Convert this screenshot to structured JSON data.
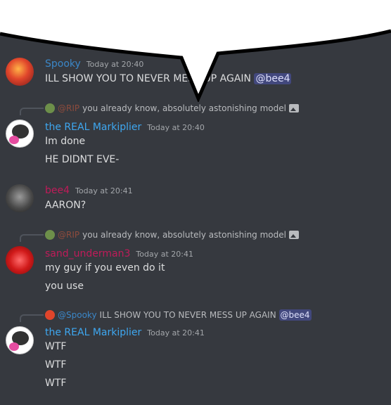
{
  "messages": [
    {
      "author": "Spooky",
      "author_color": "#3b87c8",
      "time": "Today at 20:40",
      "lines": [
        "ILL SHOW YOU TO NEVER MESS UP AGAIN"
      ],
      "mention": "@bee4"
    },
    {
      "reply": {
        "author": "@RIP",
        "text": "you already know, absolutely astonishing model"
      },
      "author": "the REAL Markiplier",
      "author_color": "#3ea7f0",
      "time": "Today at 20:40",
      "lines": [
        "Im done",
        "HE DIDNT EVE-"
      ]
    },
    {
      "author": "bee4",
      "author_color": "#c01b59",
      "time": "Today at 20:41",
      "lines": [
        "AARON?"
      ]
    },
    {
      "reply": {
        "author": "@RIP",
        "text": "you already know, absolutely astonishing model"
      },
      "author": "sand_underman3",
      "author_color": "#c01b59",
      "time": "Today at 20:41",
      "lines": [
        "my guy if you even do it",
        "you use"
      ]
    },
    {
      "reply": {
        "author": "@Spooky",
        "text": "ILL SHOW YOU TO NEVER MESS UP AGAIN",
        "mention": "@bee4"
      },
      "author": "the REAL Markiplier",
      "author_color": "#3ea7f0",
      "time": "Today at 20:41",
      "lines": [
        "WTF",
        "WTF",
        "WTF"
      ]
    }
  ],
  "colors": {
    "background": "#36393f",
    "mention_bg": "#4c5180",
    "speech_bubble": "#ffffff"
  }
}
